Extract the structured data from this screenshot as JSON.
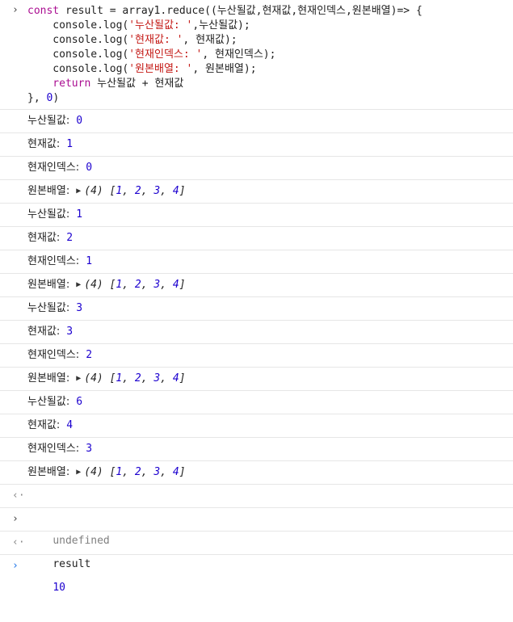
{
  "console": {
    "input": {
      "prompt": "›",
      "lines": [
        [
          {
            "t": "kw",
            "v": "const"
          },
          {
            "t": "plain",
            "v": " result = array1.reduce((누산될값,현재값,현재인덱스,원본배열)=> {"
          }
        ],
        [
          {
            "t": "plain",
            "v": "    console.log("
          },
          {
            "t": "str",
            "v": "'누산될값: '"
          },
          {
            "t": "plain",
            "v": ",누산될값);"
          }
        ],
        [
          {
            "t": "plain",
            "v": "    console.log("
          },
          {
            "t": "str",
            "v": "'현재값: '"
          },
          {
            "t": "plain",
            "v": ", 현재값);"
          }
        ],
        [
          {
            "t": "plain",
            "v": "    console.log("
          },
          {
            "t": "str",
            "v": "'현재인덱스: '"
          },
          {
            "t": "plain",
            "v": ", 현재인덱스);"
          }
        ],
        [
          {
            "t": "plain",
            "v": "    console.log("
          },
          {
            "t": "str",
            "v": "'원본배열: '"
          },
          {
            "t": "plain",
            "v": ", 원본배열);"
          }
        ],
        [
          {
            "t": "kw",
            "v": "    return"
          },
          {
            "t": "plain",
            "v": " 누산될값 + 현재값"
          }
        ],
        [
          {
            "t": "plain",
            "v": "}, "
          },
          {
            "t": "num",
            "v": "0"
          },
          {
            "t": "plain",
            "v": ")"
          }
        ]
      ]
    },
    "logs": [
      {
        "label": "누산될값:",
        "value": "0"
      },
      {
        "label": "현재값:",
        "value": "1"
      },
      {
        "label": "현재인덱스:",
        "value": "0"
      },
      {
        "label": "원본배열:",
        "array": true,
        "length": "(4)",
        "items": [
          "1",
          "2",
          "3",
          "4"
        ]
      },
      {
        "label": "누산될값:",
        "value": "1"
      },
      {
        "label": "현재값:",
        "value": "2"
      },
      {
        "label": "현재인덱스:",
        "value": "1"
      },
      {
        "label": "원본배열:",
        "array": true,
        "length": "(4)",
        "items": [
          "1",
          "2",
          "3",
          "4"
        ]
      },
      {
        "label": "누산될값:",
        "value": "3"
      },
      {
        "label": "현재값:",
        "value": "3"
      },
      {
        "label": "현재인덱스:",
        "value": "2"
      },
      {
        "label": "원본배열:",
        "array": true,
        "length": "(4)",
        "items": [
          "1",
          "2",
          "3",
          "4"
        ]
      },
      {
        "label": "누산될값:",
        "value": "6"
      },
      {
        "label": "현재값:",
        "value": "4"
      },
      {
        "label": "현재인덱스:",
        "value": "3"
      },
      {
        "label": "원본배열:",
        "array": true,
        "length": "(4)",
        "items": [
          "1",
          "2",
          "3",
          "4"
        ]
      }
    ],
    "return1": {
      "icon": "‹·",
      "text": "undefined"
    },
    "command2": {
      "prompt": "›",
      "text": "result"
    },
    "return2": {
      "icon": "‹·",
      "text": "10"
    },
    "empty_prompt": "›"
  },
  "colors": {
    "keyword": "#aa0d91",
    "string": "#c41a16",
    "number": "#1c00cf",
    "undefined": "#808080",
    "prompt_active": "#1a73e8"
  }
}
